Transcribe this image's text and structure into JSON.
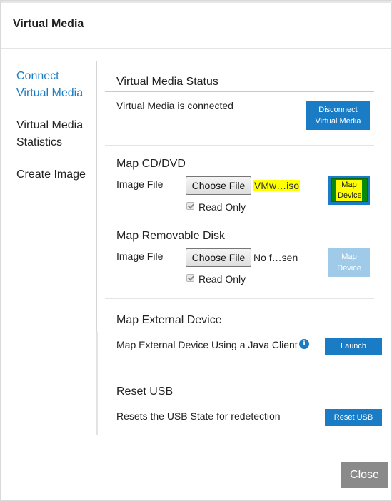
{
  "dialog": {
    "title": "Virtual Media"
  },
  "sidebar": {
    "items": [
      {
        "label": "Connect Virtual Media",
        "active": true
      },
      {
        "label": "Virtual Media Statistics",
        "active": false
      },
      {
        "label": "Create Image",
        "active": false
      }
    ]
  },
  "status": {
    "title": "Virtual Media Status",
    "text": "Virtual Media is connected",
    "button": "Disconnect Virtual Media"
  },
  "cd": {
    "title": "Map CD/DVD",
    "label": "Image File",
    "choose": "Choose File",
    "file": "VMw…iso",
    "readonly": "Read Only",
    "button": "Map Device"
  },
  "removable": {
    "title": "Map Removable Disk",
    "label": "Image File",
    "choose": "Choose File",
    "file": "No f…sen",
    "readonly": "Read Only",
    "button": "Map Device"
  },
  "external": {
    "title": "Map External Device",
    "text": "Map External Device Using a Java Client",
    "button": "Launch"
  },
  "usb": {
    "title": "Reset USB",
    "text": "Resets the USB State for redetection",
    "button": "Reset USB"
  },
  "footer": {
    "close": "Close"
  },
  "colors": {
    "accent": "#1a7cc4",
    "accent_disabled": "#9fcbe9",
    "highlight": "#ffff00",
    "close_bg": "#8a8a8a"
  }
}
